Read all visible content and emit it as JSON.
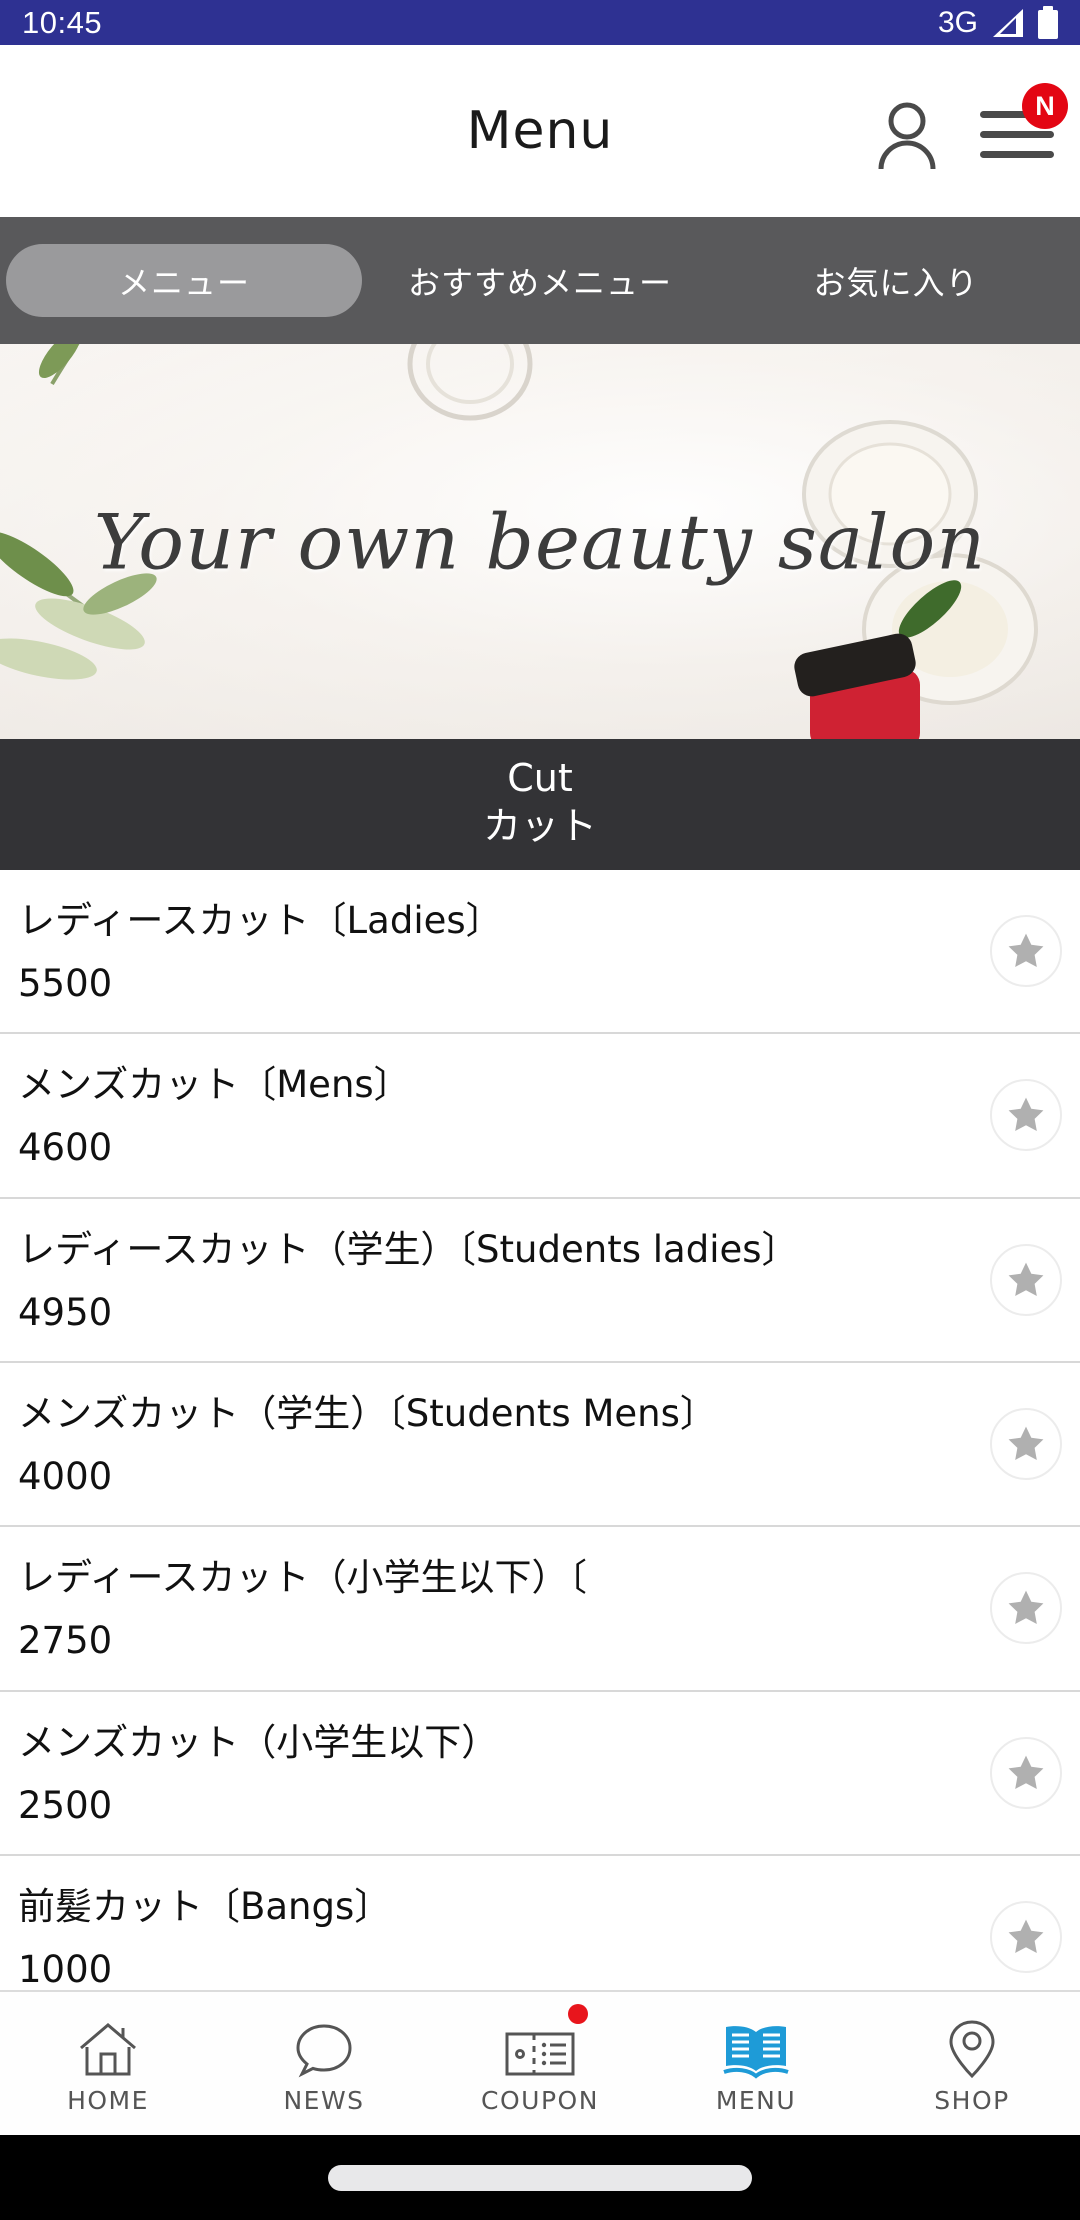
{
  "status_bar": {
    "time": "10:45",
    "network": "3G",
    "signal_icon": "signal-triangle-icon",
    "battery_icon": "battery-full-icon",
    "background_color": "#2e3192"
  },
  "header": {
    "title": "Menu",
    "account_icon": "person-icon",
    "menu_icon": "hamburger-menu-icon",
    "notification_badge": "N",
    "badge_color": "#e30613"
  },
  "tabs": [
    {
      "label": "メニュー",
      "active": true
    },
    {
      "label": "おすすめメニュー",
      "active": false
    },
    {
      "label": "お気に入り",
      "active": false
    }
  ],
  "banner": {
    "text": "Your own beauty salon",
    "alt": "beauty salon flat lay with olive branches and cream jars"
  },
  "section": {
    "title_en": "Cut",
    "title_ja": "カット",
    "background_color": "#333336"
  },
  "menu_items": [
    {
      "name": "レディースカット〔Ladies〕",
      "price": "5500",
      "favorite_icon": "star-icon"
    },
    {
      "name": "メンズカット〔Mens〕",
      "price": "4600",
      "favorite_icon": "star-icon"
    },
    {
      "name": "レディースカット（学生）〔Students ladies〕",
      "price": "4950",
      "favorite_icon": "star-icon"
    },
    {
      "name": "メンズカット（学生）〔Students Mens〕",
      "price": "4000",
      "favorite_icon": "star-icon"
    },
    {
      "name": "レディースカット（小学生以下）〔",
      "price": "2750",
      "favorite_icon": "star-icon"
    },
    {
      "name": "メンズカット（小学生以下）",
      "price": "2500",
      "favorite_icon": "star-icon"
    },
    {
      "name": "前髪カット〔Bangs〕",
      "price": "1000",
      "favorite_icon": "star-icon"
    }
  ],
  "bottom_nav": [
    {
      "label": "HOME",
      "icon": "home-icon",
      "active": false,
      "badge": false
    },
    {
      "label": "NEWS",
      "icon": "speech-bubble-icon",
      "active": false,
      "badge": false
    },
    {
      "label": "COUPON",
      "icon": "ticket-icon",
      "active": false,
      "badge": true
    },
    {
      "label": "MENU",
      "icon": "open-book-icon",
      "active": true,
      "badge": false
    },
    {
      "label": "SHOP",
      "icon": "location-pin-icon",
      "active": false,
      "badge": false
    }
  ],
  "colors": {
    "status_bar": "#2e3192",
    "tab_strip": "#59595b",
    "tab_active": "#9a9a9c",
    "section_header": "#333336",
    "active_nav": "#1e9bd7",
    "badge_red": "#e8151c"
  }
}
